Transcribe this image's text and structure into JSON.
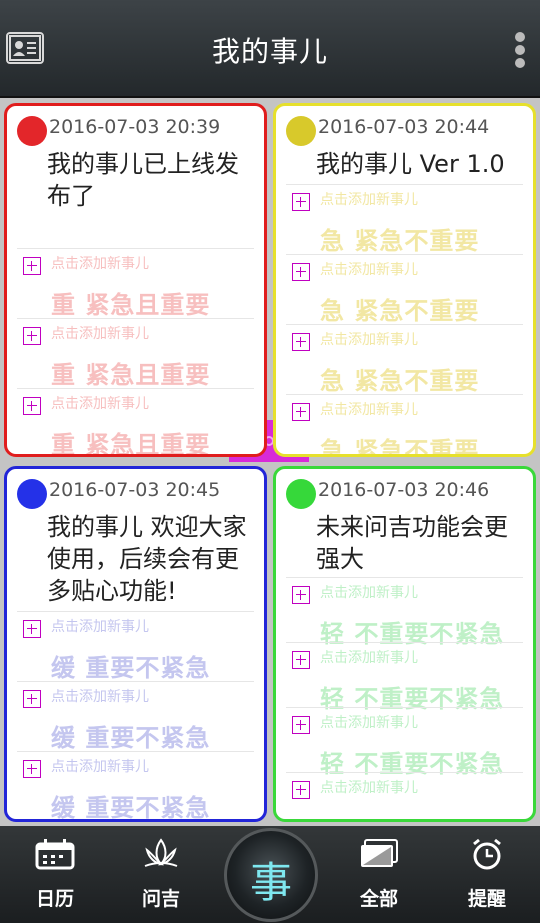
{
  "header": {
    "title": "我的事儿",
    "contact_icon": "contact-card-icon",
    "menu_icon": "overflow-menu-icon"
  },
  "slot_hint": "点击添加新事儿",
  "cards": [
    {
      "color": "#e3262a",
      "border": "#e01d1d",
      "date": "2016-07-03 20:39",
      "text": "我的事儿已上线发布了",
      "tag": "重 紧急且重要",
      "tag_color": "#f7bfbf"
    },
    {
      "color": "#d8c92b",
      "border": "#e6e02c",
      "date": "2016-07-03 20:44",
      "text": "我的事儿 Ver 1.0",
      "tag": "急 紧急不重要",
      "tag_color": "#f2e7a3"
    },
    {
      "color": "#2431e8",
      "border": "#2225d8",
      "date": "2016-07-03 20:45",
      "text": "我的事儿 欢迎大家使用，后续会有更多贴心功能!",
      "tag": "缓  重要不紧急",
      "tag_color": "#c4c6ef"
    },
    {
      "color": "#36d83a",
      "border": "#3ad83a",
      "date": "2016-07-03 20:46",
      "text": "未来问吉功能会更强大",
      "tag": "轻  不重要不紧急",
      "tag_color": "#bff0c7"
    }
  ],
  "tabs": {
    "calendar": {
      "label": "日历",
      "icon": "calendar-icon"
    },
    "wenji": {
      "label": "问吉",
      "icon": "lotus-icon"
    },
    "center": {
      "glyph": "事"
    },
    "all": {
      "label": "全部",
      "icon": "card-stack-icon"
    },
    "reminder": {
      "label": "提醒",
      "icon": "alarm-clock-icon"
    }
  }
}
